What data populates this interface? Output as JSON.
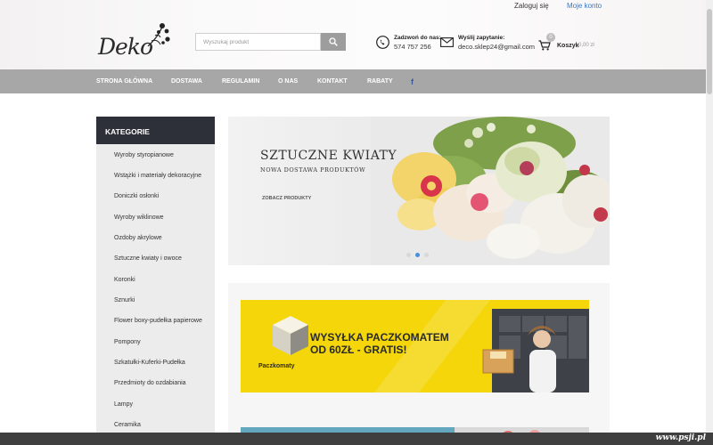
{
  "top_links": {
    "login": "Zaloguj się",
    "account": "Moje konto"
  },
  "logo": {
    "text": "Deko"
  },
  "search": {
    "placeholder": "Wyszukaj produkt",
    "icon": "search-icon"
  },
  "contact": {
    "phone_title": "Zadzwoń do nas:",
    "phone_value": "574 757 256",
    "mail_title": "Wyślij zapytanie:",
    "mail_value": "deco.sklep24@gmail.com"
  },
  "cart": {
    "label": "Koszyk",
    "amount": "0,00 zł",
    "count": "0"
  },
  "nav": {
    "items": [
      "Strona główna",
      "Dostawa",
      "Regulamin",
      "O nas",
      "Kontakt",
      "Rabaty"
    ],
    "social": "f"
  },
  "sidebar": {
    "title": "KATEGORIE",
    "items": [
      "Wyroby styropianowe",
      "Wstążki i materiały dekoracyjne",
      "Doniczki osłonki",
      "Wyroby wiklinowe",
      "Ozdoby akrylowe",
      "Sztuczne kwiaty i owoce",
      "Koronki",
      "Sznurki",
      "Flower boxy-pudełka papierowe",
      "Pompony",
      "Szkatułki-Kuferki-Pudełka",
      "Przedmioty do ozdabiania",
      "Lampy",
      "Ceramika"
    ]
  },
  "hero": {
    "title": "SZTUCZNE KWIATY",
    "subtitle": "NOWA DOSTAWA PRODUKTÓW",
    "button": "ZOBACZ PRODUKTY",
    "slide_count": 3,
    "active_slide": 2
  },
  "promo": {
    "line1": "WYSYŁKA PACZKOMATEM",
    "line2": "OD 60ZŁ - GRATIS!",
    "brand": "Paczkomaty"
  },
  "watermark": "www.psji.pl",
  "colors": {
    "nav_bg": "#a7a7a7",
    "sidebar_head": "#2d3038",
    "promo_yellow": "#f4d60b",
    "link_blue": "#3a78c4",
    "active_dot": "#4a90d9"
  }
}
